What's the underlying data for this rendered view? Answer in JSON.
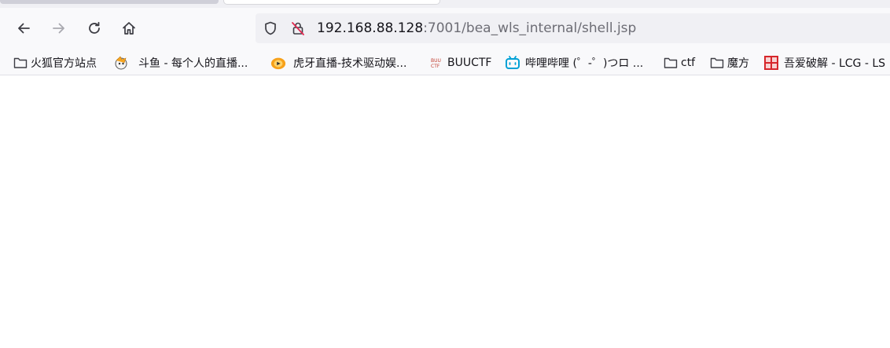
{
  "url": {
    "host": "192.168.88.128",
    "path": ":7001/bea_wls_internal/shell.jsp"
  },
  "bookmarks": [
    {
      "label": "火狐官方站点",
      "icon": "folder-icon"
    },
    {
      "label": "斗鱼 - 每个人的直播...",
      "icon": "douyu-icon"
    },
    {
      "label": "虎牙直播-技术驱动娱...",
      "icon": "huya-icon"
    },
    {
      "label": "BUUCTF",
      "icon": "buuctf-icon"
    },
    {
      "label": "哔哩哔哩 (゜-゜)つロ ...",
      "icon": "bilibili-icon"
    },
    {
      "label": "ctf",
      "icon": "folder-icon"
    },
    {
      "label": "魔方",
      "icon": "folder-icon"
    },
    {
      "label": "吾爱破解 - LCG - LS",
      "icon": "52pojie-icon"
    }
  ],
  "colors": {
    "toolbar_bg": "#f9f9fb",
    "urlbar_bg": "#f0f0f4",
    "text": "#15141a",
    "muted_text": "#6d6d75"
  }
}
